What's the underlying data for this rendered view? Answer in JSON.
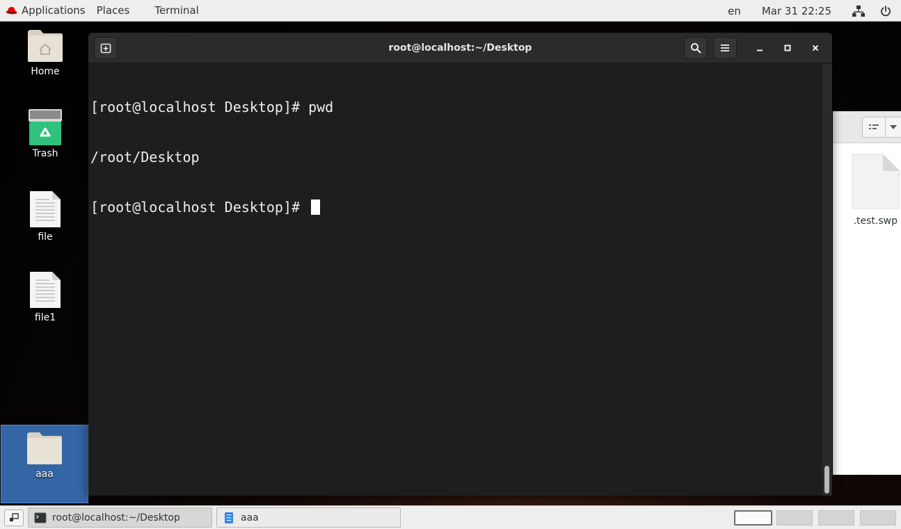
{
  "topbar": {
    "applications_label": "Applications",
    "places_label": "Places",
    "terminal_label": "Terminal",
    "language": "en",
    "clock": "Mar 31  22:25"
  },
  "desktop_icons": [
    {
      "label": "Home",
      "icon": "home-folder-icon"
    },
    {
      "label": "Trash",
      "icon": "trash-icon"
    },
    {
      "label": "file",
      "icon": "text-file-icon"
    },
    {
      "label": "file1",
      "icon": "text-file-icon"
    },
    {
      "label": "aaa",
      "icon": "folder-icon",
      "selected": true
    }
  ],
  "terminal": {
    "title": "root@localhost:~/Desktop",
    "lines": [
      "[root@localhost Desktop]# pwd",
      "/root/Desktop",
      "[root@localhost Desktop]# "
    ]
  },
  "file_manager": {
    "file_label": ".test.swp"
  },
  "taskbar": {
    "items": [
      {
        "label": "root@localhost:~/Desktop",
        "icon": "terminal-icon",
        "active": true
      },
      {
        "label": "aaa",
        "icon": "file-manager-icon",
        "active": false
      }
    ],
    "workspaces": 4,
    "active_workspace": 1
  },
  "colors": {
    "terminal_bg": "#1e1e1e",
    "panel_bg": "#eeeeec",
    "selection": "#3465a4",
    "redhat": "#ee0000"
  }
}
